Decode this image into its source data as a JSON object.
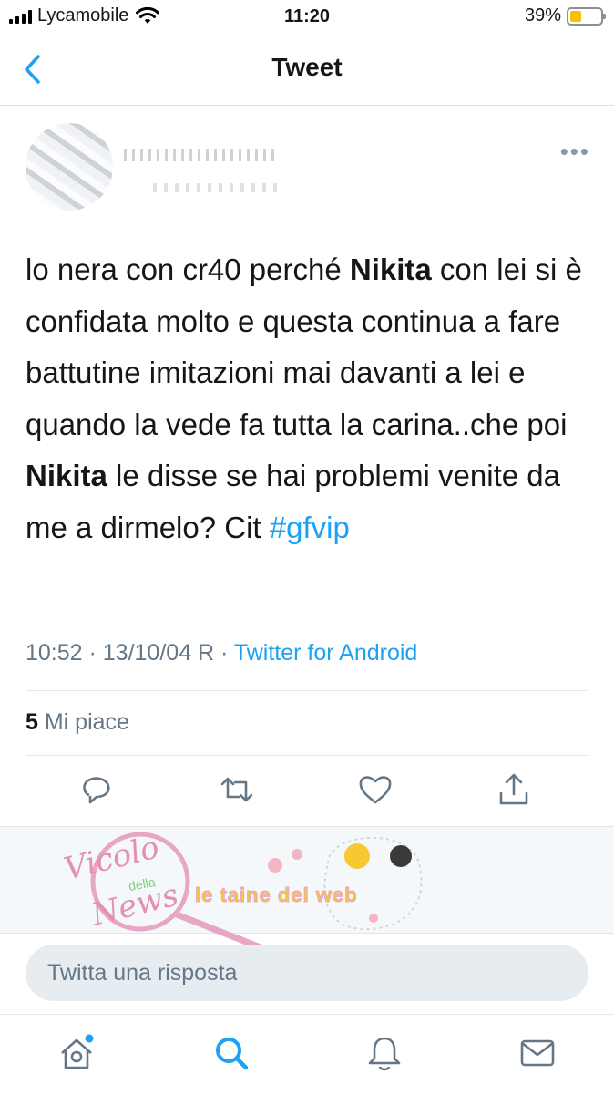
{
  "status": {
    "carrier": "Lycamobile",
    "time": "11:20",
    "battery": "39%",
    "battery_level": 0.39
  },
  "nav": {
    "title": "Tweet"
  },
  "tweet": {
    "text_parts": [
      "lo nera con cr40 perché ",
      "Nikita",
      " con lei si è confidata molto e questa continua a fare battutine imitazioni mai davanti a lei e quando la vede fa tutta la carina..che poi ",
      "Nikita",
      " le disse se hai problemi venite da me a dirmelo? Cit "
    ],
    "hashtag": "#gfvip",
    "timestamp": "10:52 · 13/10/04 R · ",
    "source": "Twitter for Android",
    "likes_count": "5",
    "likes_label": " Mi piace"
  },
  "watermark": {
    "logo_lines": [
      "Vicolo",
      "della",
      "News"
    ],
    "caption": "le taine del web"
  },
  "reply": {
    "placeholder": "Twitta una risposta"
  },
  "icons": {
    "back": "chevron-left-icon",
    "more": "more-horizontal-icon",
    "reply": "reply-icon",
    "retweet": "retweet-icon",
    "like": "heart-icon",
    "share": "share-icon",
    "home": "home-icon",
    "search": "search-icon",
    "notifications": "bell-icon",
    "messages": "mail-icon"
  },
  "colors": {
    "accent": "#1da1f2",
    "secondary_text": "#657786",
    "icon_gray": "#657786"
  }
}
